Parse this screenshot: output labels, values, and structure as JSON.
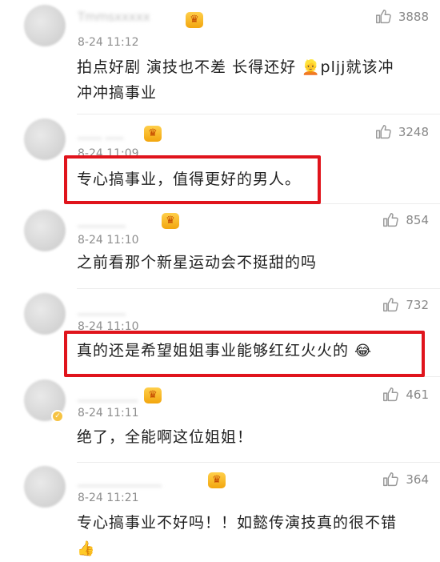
{
  "comments": [
    {
      "name": "Tmmsxxxxx",
      "time": "8-24 11:12",
      "likes": "3888",
      "text": "拍点好剧 演技也不差 长得还好 ",
      "text2": "pljj就该冲冲冲搞事业",
      "emoji": "👱"
    },
    {
      "name": "____  ___",
      "time": "8-24 11:09",
      "likes": "3248",
      "text": "专心搞事业，值得更好的男人。"
    },
    {
      "name": "________",
      "time": "8-24 11:10",
      "likes": "854",
      "text": "之前看那个新星运动会不挺甜的吗"
    },
    {
      "name": "________",
      "time": "8-24 11:10",
      "likes": "732",
      "text": "真的还是希望姐姐事业能够红红火火的 ",
      "emoji": "😂"
    },
    {
      "name": "__________",
      "time": "8-24 11:11",
      "likes": "461",
      "text": "绝了，全能啊这位姐姐！"
    },
    {
      "name": "______________",
      "time": "8-24 11:21",
      "likes": "364",
      "text": "专心搞事业不好吗！！如懿传演技真的很不错",
      "emoji": "👍"
    }
  ],
  "icons": {
    "like": "thumbs-up-icon",
    "crown": "crown-icon",
    "verified": "verified-badge-icon"
  },
  "colors": {
    "highlight_box": "#e0141c",
    "crown": "#f2a60e",
    "meta": "#8e8e8e"
  }
}
